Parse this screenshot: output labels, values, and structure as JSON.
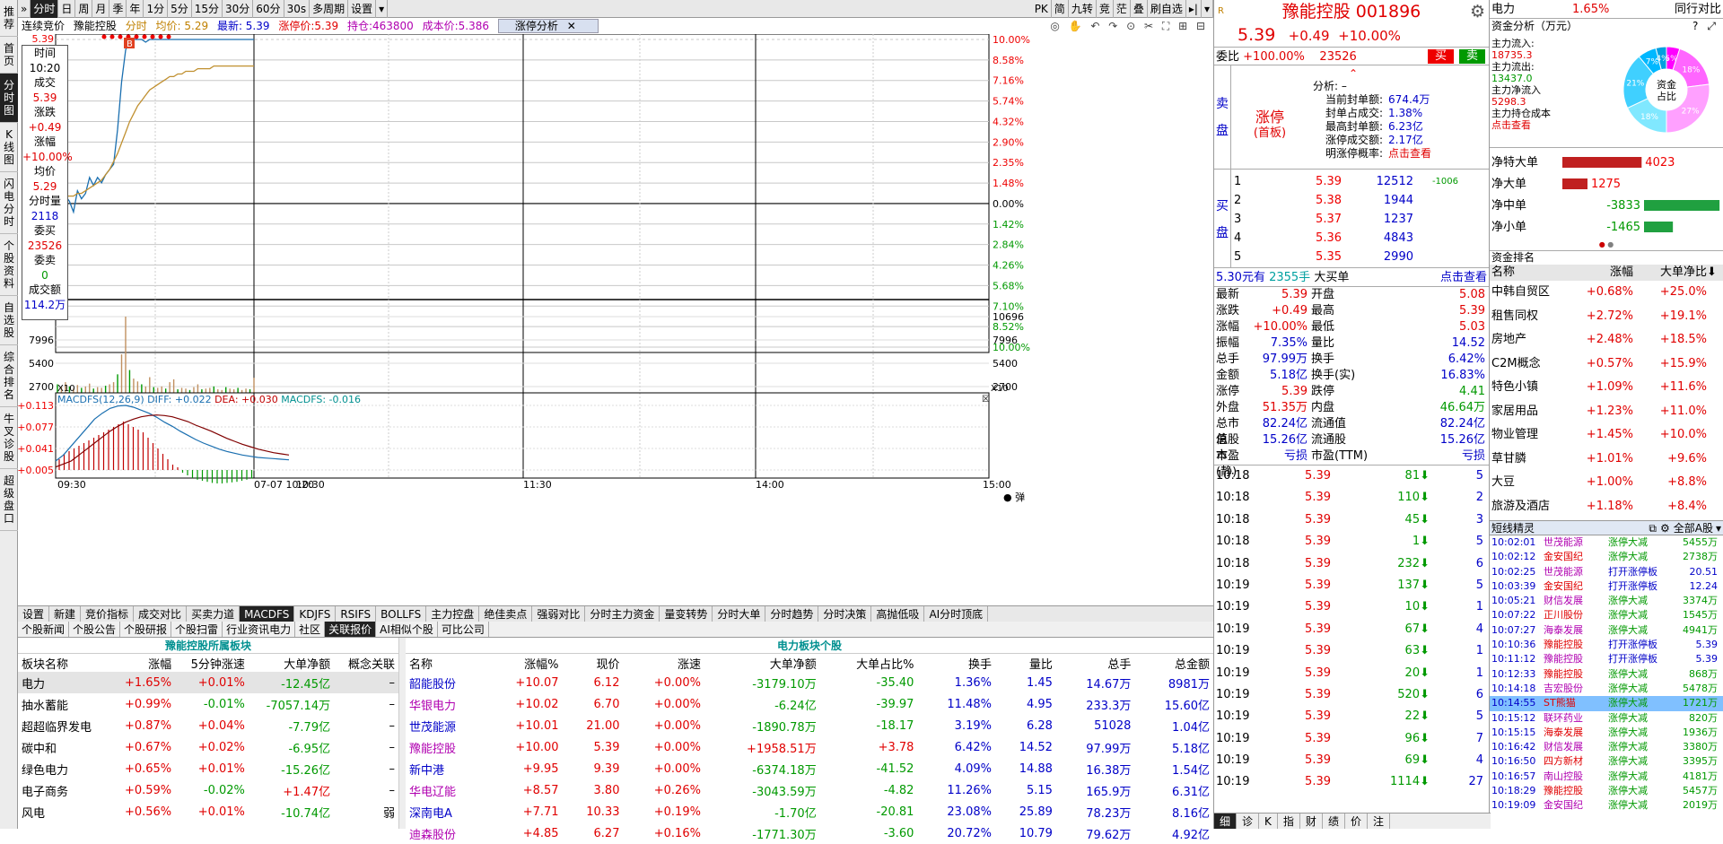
{
  "nav": [
    "推荐",
    "首页",
    "分时图",
    "K线图",
    "闪电分时",
    "个股资料",
    "自选股",
    "综合排名",
    "牛叉诊股",
    "超级盘口"
  ],
  "nav_active": 2,
  "toolbar": {
    "left": [
      "分时",
      "日",
      "周",
      "月",
      "季",
      "年",
      "1分",
      "5分",
      "15分",
      "30分",
      "60分",
      "30s",
      "多周期",
      "设置"
    ],
    "active": 0,
    "right": [
      "PK",
      "简",
      "九转",
      "竞",
      "茫",
      "叠",
      "刷自选"
    ]
  },
  "info": {
    "mode": "连续竞价",
    "name": "豫能控股",
    "label1": "分时",
    "avg": "均价: 5.29",
    "latest": "最新: 5.39",
    "limit": "涨停价:5.39",
    "hold": "持仓:463800",
    "cost": "成本价:5.386",
    "limit_btn": "涨停分析"
  },
  "hover": {
    "time_label": "时间",
    "time": "10:20",
    "price_label": "成交",
    "price": "5.39",
    "chg_label": "涨跌",
    "chg": "+0.49",
    "pct_label": "涨幅",
    "pct": "+10.00%",
    "avg_label": "均价",
    "avg": "5.29",
    "vol_label": "分时量",
    "vol": "2118",
    "buy_label": "委买",
    "buy": "23526",
    "sell_label": "委卖",
    "sell": "0",
    "amt_label": "成交额",
    "amt": "114.2万"
  },
  "chart_data": {
    "type": "line",
    "title": "",
    "x_ticks": [
      "09:30",
      "07-07 10:20",
      "10:30",
      "11:30",
      "14:00",
      "15:00"
    ],
    "price_left_ticks": [
      "5.39",
      "4.48",
      "4.41"
    ],
    "price_right_ticks": [
      "10.00%",
      "8.58%",
      "7.16%",
      "5.74%",
      "4.32%",
      "2.90%",
      "2.35%",
      "1.48%",
      "0.00%",
      "1.42%",
      "2.84%",
      "4.26%",
      "5.68%",
      "7.10%",
      "8.52%",
      "10.00%"
    ],
    "vol_ticks": [
      "10696",
      "7996",
      "5400",
      "2700"
    ],
    "macd_label": "MACDFS(12,26,9)",
    "macd_diff": "DIFF: +0.022",
    "macd_dea": "DEA: +0.030",
    "macd_macdfs": "MACDFS: -0.016",
    "macd_ticks": [
      "+0.113",
      "+0.077",
      "+0.041",
      "+0.005"
    ],
    "price_series": [
      4.75,
      4.76,
      4.8,
      4.78,
      4.74,
      4.82,
      4.79,
      4.81,
      4.87,
      4.84,
      4.87,
      4.85,
      4.88,
      4.9,
      4.92,
      5.05,
      5.23,
      5.35,
      5.39,
      5.39,
      5.39,
      5.39,
      5.38,
      5.39,
      5.39,
      5.39,
      5.39,
      5.39,
      5.39,
      5.39,
      5.39,
      5.39,
      5.39,
      5.39,
      5.39,
      5.39,
      5.39,
      5.39,
      5.39,
      5.39,
      5.39,
      5.39,
      5.39,
      5.39,
      5.39,
      5.39,
      5.39,
      5.39,
      5.39,
      5.39
    ],
    "avg_series": [
      4.78,
      4.79,
      4.8,
      4.8,
      4.8,
      4.81,
      4.81,
      4.82,
      4.83,
      4.84,
      4.85,
      4.86,
      4.88,
      4.9,
      4.93,
      4.96,
      5.0,
      5.04,
      5.08,
      5.11,
      5.14,
      5.16,
      5.18,
      5.2,
      5.21,
      5.22,
      5.23,
      5.24,
      5.25,
      5.25,
      5.26,
      5.26,
      5.27,
      5.27,
      5.27,
      5.28,
      5.28,
      5.28,
      5.28,
      5.29,
      5.29,
      5.29,
      5.29,
      5.29,
      5.29,
      5.29,
      5.29,
      5.29,
      5.29,
      5.29
    ],
    "vol_series": [
      1200,
      800,
      1500,
      900,
      600,
      1100,
      700,
      900,
      1300,
      600,
      800,
      700,
      1000,
      1200,
      1500,
      2600,
      5400,
      10696,
      3200,
      2000,
      1600,
      1200,
      900,
      2200,
      800,
      700,
      900,
      600,
      1500,
      1900,
      500,
      700,
      600,
      400,
      800,
      1200,
      500,
      600,
      700,
      900,
      500,
      400,
      800,
      600,
      500,
      700,
      400,
      600,
      500,
      2118
    ],
    "macd_hist": [
      0.02,
      0.03,
      0.035,
      0.04,
      0.045,
      0.05,
      0.055,
      0.06,
      0.065,
      0.07,
      0.075,
      0.08,
      0.085,
      0.09,
      0.085,
      0.08,
      0.075,
      0.07,
      0.06,
      0.05,
      0.04,
      0.03,
      0.02,
      0.01,
      0.005,
      -0.005,
      -0.01,
      -0.015,
      -0.018,
      -0.02,
      -0.022,
      -0.024,
      -0.025,
      -0.025,
      -0.024,
      -0.023,
      -0.022,
      -0.02,
      -0.018,
      -0.016
    ],
    "diff_series": [
      0.02,
      0.03,
      0.045,
      0.06,
      0.075,
      0.09,
      0.1,
      0.108,
      0.112,
      0.113,
      0.11,
      0.105,
      0.1,
      0.093,
      0.085,
      0.078,
      0.07,
      0.063,
      0.056,
      0.05,
      0.045,
      0.04,
      0.036,
      0.033,
      0.03,
      0.028,
      0.026,
      0.025,
      0.024,
      0.023,
      0.022
    ],
    "dea_series": [
      0.01,
      0.015,
      0.02,
      0.03,
      0.04,
      0.05,
      0.06,
      0.07,
      0.078,
      0.085,
      0.09,
      0.094,
      0.096,
      0.097,
      0.096,
      0.094,
      0.09,
      0.086,
      0.08,
      0.075,
      0.07,
      0.064,
      0.058,
      0.053,
      0.048,
      0.044,
      0.04,
      0.037,
      0.034,
      0.032,
      0.03
    ]
  },
  "bottom_tabs": [
    "设置",
    "新建",
    "竞价指标",
    "成交对比",
    "买卖力道",
    "MACDFS",
    "KDJFS",
    "RSIFS",
    "BOLLFS",
    "主力控盘",
    "绝佳卖点",
    "强弱对比",
    "分时主力资金",
    "量变转势",
    "分时大单",
    "分时趋势",
    "分时决策",
    "高抛低吸",
    "AI分时顶底"
  ],
  "bottom_active": 5,
  "sub_tabs": [
    "个股新闻",
    "个股公告",
    "个股研报",
    "个股扫雷",
    "行业资讯电力",
    "社区",
    "关联报价",
    "AI相似个股",
    "可比公司"
  ],
  "sub_active": 6,
  "sector_table": {
    "title": "豫能控股所属板块",
    "headers": [
      "板块名称",
      "涨幅",
      "5分钟涨速",
      "大单净额",
      "概念关联"
    ],
    "rows": [
      [
        "电力",
        "+1.65%",
        "+0.01%",
        "-12.45亿",
        "–"
      ],
      [
        "抽水蓄能",
        "+0.99%",
        "-0.01%",
        "-7057.14万",
        "–"
      ],
      [
        "超超临界发电",
        "+0.87%",
        "+0.04%",
        "-7.79亿",
        "–"
      ],
      [
        "碳中和",
        "+0.67%",
        "+0.02%",
        "-6.95亿",
        "–"
      ],
      [
        "绿色电力",
        "+0.65%",
        "+0.01%",
        "-15.26亿",
        "–"
      ],
      [
        "电子商务",
        "+0.59%",
        "-0.02%",
        "+1.47亿",
        "–"
      ],
      [
        "风电",
        "+0.56%",
        "+0.01%",
        "-10.74亿",
        "弱"
      ]
    ]
  },
  "stock_table": {
    "title": "电力板块个股",
    "headers": [
      "名称",
      "涨幅%",
      "现价",
      "涨速",
      "大单净额",
      "大单占比%",
      "换手",
      "量比",
      "总手",
      "总金额"
    ],
    "rows": [
      [
        "韶能股份",
        "+10.07",
        "6.12",
        "+0.00%",
        "-3179.10万",
        "-35.40",
        "1.36%",
        "1.45",
        "14.67万",
        "8981万"
      ],
      [
        "华银电力",
        "+10.02",
        "6.70",
        "+0.00%",
        "-6.24亿",
        "-39.97",
        "11.48%",
        "4.95",
        "233.3万",
        "15.60亿"
      ],
      [
        "世茂能源",
        "+10.01",
        "21.00",
        "+0.00%",
        "-1890.78万",
        "-18.17",
        "3.19%",
        "6.28",
        "51028",
        "1.04亿"
      ],
      [
        "豫能控股",
        "+10.00",
        "5.39",
        "+0.00%",
        "+1958.51万",
        "+3.78",
        "6.42%",
        "14.52",
        "97.99万",
        "5.18亿"
      ],
      [
        "新中港",
        "+9.95",
        "9.39",
        "+0.00%",
        "-6374.18万",
        "-41.52",
        "4.09%",
        "14.88",
        "16.38万",
        "1.54亿"
      ],
      [
        "华电辽能",
        "+8.57",
        "3.80",
        "+0.26%",
        "-3043.59万",
        "-4.82",
        "11.26%",
        "5.15",
        "165.9万",
        "6.31亿"
      ],
      [
        "深南电A",
        "+7.71",
        "10.33",
        "+0.19%",
        "-1.70亿",
        "-20.81",
        "23.08%",
        "25.89",
        "78.23万",
        "8.16亿"
      ],
      [
        "迪森股份",
        "+4.85",
        "6.27",
        "+0.16%",
        "-1771.30万",
        "-3.60",
        "20.72%",
        "10.79",
        "79.62万",
        "4.92亿"
      ]
    ]
  },
  "quote": {
    "name": "豫能控股 001896",
    "price": "5.39",
    "chg": "+0.49",
    "pct": "+10.00%",
    "wb_label": "委比",
    "wb": "+100.00%",
    "wb_vol": "23526",
    "buy_btn": "买",
    "sell_btn": "卖",
    "sell_side": "卖盘",
    "buy_side": "买盘",
    "limit_text": "涨停",
    "limit_sub": "(首板)",
    "analysis": {
      "title": "分析: –",
      "rows": [
        [
          "当前封单额:",
          "674.4万"
        ],
        [
          "封单占成交:",
          "1.38%"
        ],
        [
          "最高封单额:",
          "6.23亿"
        ],
        [
          "涨停成交额:",
          "2.17亿"
        ],
        [
          "明涨停概率:",
          "点击查看"
        ]
      ]
    },
    "bids": [
      [
        "1",
        "5.39",
        "12512",
        "-1006"
      ],
      [
        "2",
        "5.38",
        "1944",
        ""
      ],
      [
        "3",
        "5.37",
        "1237",
        ""
      ],
      [
        "4",
        "5.36",
        "4843",
        ""
      ],
      [
        "5",
        "5.35",
        "2990",
        ""
      ]
    ],
    "bigbuy": {
      "price": "5.30元有",
      "vol": "2355手",
      "label": "大买单",
      "link": "点击查看"
    },
    "stats": [
      [
        "最新",
        "5.39",
        "开盘",
        "5.08"
      ],
      [
        "涨跌",
        "+0.49",
        "最高",
        "5.39"
      ],
      [
        "涨幅",
        "+10.00%",
        "最低",
        "5.03"
      ],
      [
        "振幅",
        "7.35%",
        "量比",
        "14.52"
      ],
      [
        "总手",
        "97.99万",
        "换手",
        "6.42%"
      ],
      [
        "金额",
        "5.18亿",
        "换手(实)",
        "16.83%"
      ],
      [
        "涨停",
        "5.39",
        "跌停",
        "4.41"
      ],
      [
        "外盘",
        "51.35万",
        "内盘",
        "46.64万"
      ],
      [
        "总市值",
        "82.24亿",
        "流通值",
        "82.24亿"
      ],
      [
        "总股本",
        "15.26亿",
        "流通股",
        "15.26亿"
      ],
      [
        "市盈(静)",
        "亏损",
        "市盈(TTM)",
        "亏损"
      ]
    ],
    "ticks": [
      [
        "10:18",
        "5.39",
        "81",
        "5"
      ],
      [
        "10:18",
        "5.39",
        "110",
        "2"
      ],
      [
        "10:18",
        "5.39",
        "45",
        "3"
      ],
      [
        "10:18",
        "5.39",
        "1",
        "5"
      ],
      [
        "10:18",
        "5.39",
        "232",
        "6"
      ],
      [
        "10:19",
        "5.39",
        "137",
        "5"
      ],
      [
        "10:19",
        "5.39",
        "10",
        "1"
      ],
      [
        "10:19",
        "5.39",
        "67",
        "4"
      ],
      [
        "10:19",
        "5.39",
        "63",
        "1"
      ],
      [
        "10:19",
        "5.39",
        "20",
        "1"
      ],
      [
        "10:19",
        "5.39",
        "520",
        "6"
      ],
      [
        "10:19",
        "5.39",
        "22",
        "5"
      ],
      [
        "10:19",
        "5.39",
        "96",
        "7"
      ],
      [
        "10:19",
        "5.39",
        "69",
        "4"
      ],
      [
        "10:19",
        "5.39",
        "1114",
        "27"
      ]
    ],
    "bottom": [
      "细",
      "诊",
      "K",
      "指",
      "财",
      "绩",
      "价",
      "注"
    ]
  },
  "fund": {
    "sector": "电力",
    "sector_pct": "1.65%",
    "peer": "同行对比",
    "title": "资金分析（万元）",
    "help": "?",
    "ranking": "资金排名",
    "inflow_label": "主力流入:",
    "inflow": "18735.3",
    "outflow_label": "主力流出:",
    "outflow": "13437.0",
    "net_label": "主力净流入",
    "net": "5298.3",
    "cost_label": "主力持仓成本",
    "cost_link": "点击查看",
    "donut_center": "资金占比",
    "donut": [
      {
        "v": 5,
        "label": "5%",
        "color": "#ff00ff"
      },
      {
        "v": 18,
        "label": "18%",
        "color": "#ff66ff"
      },
      {
        "v": 27,
        "label": "27%",
        "color": "#ffa0ff"
      },
      {
        "v": 18,
        "label": "18%",
        "color": "#80e8ff"
      },
      {
        "v": 21,
        "label": "21%",
        "color": "#40d0ff"
      },
      {
        "v": 7,
        "label": "7%",
        "color": "#00b8ff"
      },
      {
        "v": 4,
        "label": "4%",
        "color": "#00a0e0"
      }
    ],
    "bars": [
      {
        "label": "净特大单",
        "value": 4023,
        "text": "4023"
      },
      {
        "label": "净大单",
        "value": 1275,
        "text": "1275"
      },
      {
        "label": "净中单",
        "value": -3833,
        "text": "-3833"
      },
      {
        "label": "净小单",
        "value": -1465,
        "text": "-1465"
      }
    ],
    "rank_headers": [
      "名称",
      "涨幅",
      "大单净比"
    ],
    "rank": [
      [
        "中韩自贸区",
        "+0.68%",
        "+25.0%"
      ],
      [
        "租售同权",
        "+2.72%",
        "+19.1%"
      ],
      [
        "房地产",
        "+2.48%",
        "+18.5%"
      ],
      [
        "C2M概念",
        "+0.57%",
        "+15.9%"
      ],
      [
        "特色小镇",
        "+1.09%",
        "+11.6%"
      ],
      [
        "家居用品",
        "+1.23%",
        "+11.0%"
      ],
      [
        "物业管理",
        "+1.45%",
        "+10.0%"
      ],
      [
        "草甘膦",
        "+1.01%",
        "+9.6%"
      ],
      [
        "大豆",
        "+1.00%",
        "+8.8%"
      ],
      [
        "旅游及酒店",
        "+1.18%",
        "+8.4%"
      ]
    ]
  },
  "shortline": {
    "title": "短线精灵",
    "filter": "全部A股",
    "rows": [
      [
        "10:02:01",
        "世茂能源",
        "涨停大减",
        "5455万"
      ],
      [
        "10:02:12",
        "金安国纪",
        "涨停大减",
        "2738万"
      ],
      [
        "10:02:25",
        "世茂能源",
        "打开涨停板",
        "20.51"
      ],
      [
        "10:03:39",
        "金安国纪",
        "打开涨停板",
        "12.24"
      ],
      [
        "10:05:21",
        "财信发展",
        "涨停大减",
        "3374万"
      ],
      [
        "10:07:22",
        "正川股份",
        "涨停大减",
        "1545万"
      ],
      [
        "10:07:27",
        "海泰发展",
        "涨停大减",
        "4941万"
      ],
      [
        "10:10:36",
        "豫能控股",
        "打开涨停板",
        "5.39"
      ],
      [
        "10:11:12",
        "豫能控股",
        "打开涨停板",
        "5.39"
      ],
      [
        "10:12:33",
        "豫能控股",
        "涨停大减",
        "868万"
      ],
      [
        "10:14:18",
        "吉宏股份",
        "涨停大减",
        "5478万"
      ],
      [
        "10:14:55",
        "ST熊猫",
        "涨停大减",
        "1721万"
      ],
      [
        "10:15:12",
        "联环药业",
        "涨停大减",
        "820万"
      ],
      [
        "10:15:15",
        "海泰发展",
        "涨停大减",
        "1936万"
      ],
      [
        "10:16:42",
        "财信发展",
        "涨停大减",
        "3380万"
      ],
      [
        "10:16:50",
        "四方新材",
        "涨停大减",
        "3395万"
      ],
      [
        "10:16:57",
        "南山控股",
        "涨停大减",
        "4181万"
      ],
      [
        "10:18:29",
        "豫能控股",
        "涨停大减",
        "5457万"
      ],
      [
        "10:19:09",
        "金安国纪",
        "涨停大减",
        "2019万"
      ]
    ],
    "highlight": 11
  }
}
